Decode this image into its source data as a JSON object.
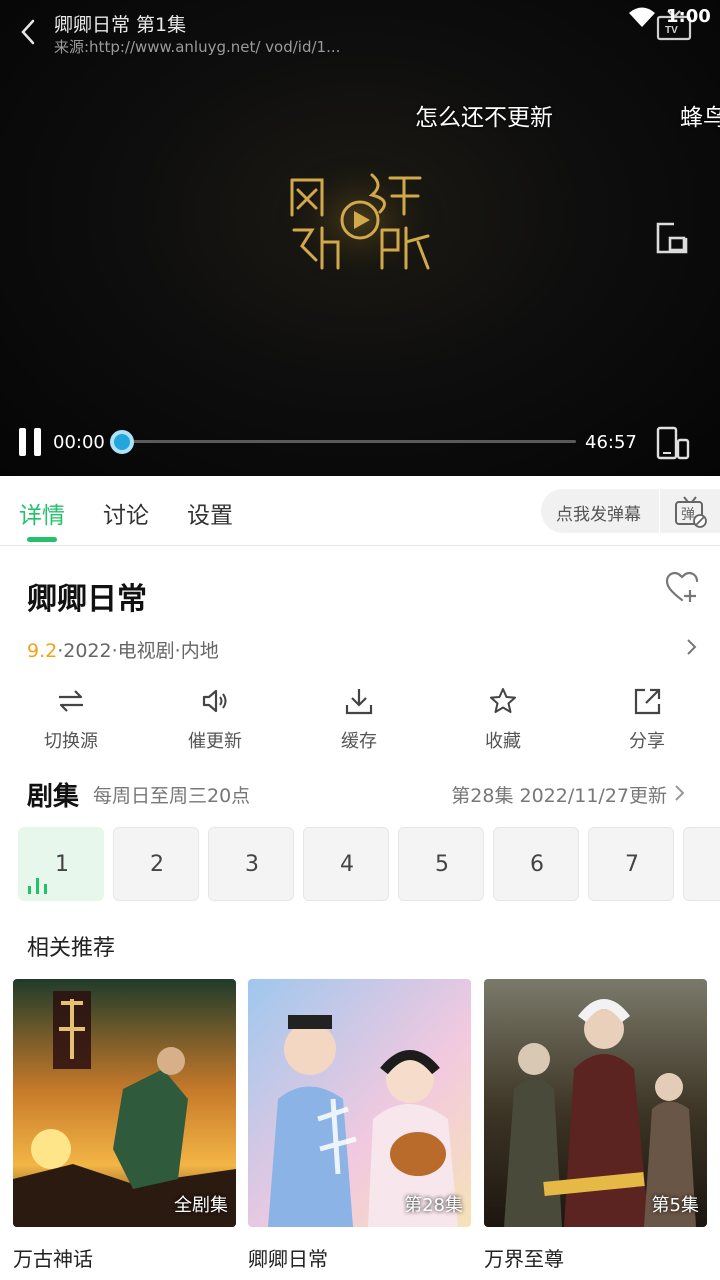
{
  "status_bar": {
    "time": "1:00"
  },
  "player": {
    "title": "卿卿日常 第1集",
    "source": "来源:http://www.anluyg.net/  vod/id/1...",
    "danmaku": [
      "怎么还不更新",
      "蜂鸟"
    ],
    "current_time": "00:00",
    "total_time": "46:57",
    "progress": 0,
    "accent_color": "#23a6dc"
  },
  "tabs": {
    "items": [
      "详情",
      "讨论",
      "设置"
    ],
    "active": 0,
    "danmaku_placeholder": "点我发弹幕"
  },
  "details": {
    "title": "卿卿日常",
    "score": "9.2",
    "meta": "·2022·电视剧·内地",
    "score_color": "#f0a21b"
  },
  "actions": [
    {
      "label": "切换源",
      "icon": "switch-source-icon"
    },
    {
      "label": "催更新",
      "icon": "speaker-icon"
    },
    {
      "label": "缓存",
      "icon": "download-icon"
    },
    {
      "label": "收藏",
      "icon": "star-icon"
    },
    {
      "label": "分享",
      "icon": "share-icon"
    }
  ],
  "episodes": {
    "title": "剧集",
    "schedule": "每周日至周三20点",
    "update": "第28集  2022/11/27更新",
    "items": [
      "1",
      "2",
      "3",
      "4",
      "5",
      "6",
      "7"
    ],
    "active": 0,
    "accent_color": "#23c26a"
  },
  "recommend": {
    "title": "相关推荐",
    "items": [
      {
        "name": "万古神话",
        "badge": "全剧集"
      },
      {
        "name": "卿卿日常",
        "badge": "第28集"
      },
      {
        "name": "万界至尊",
        "badge": "第5集"
      }
    ]
  }
}
